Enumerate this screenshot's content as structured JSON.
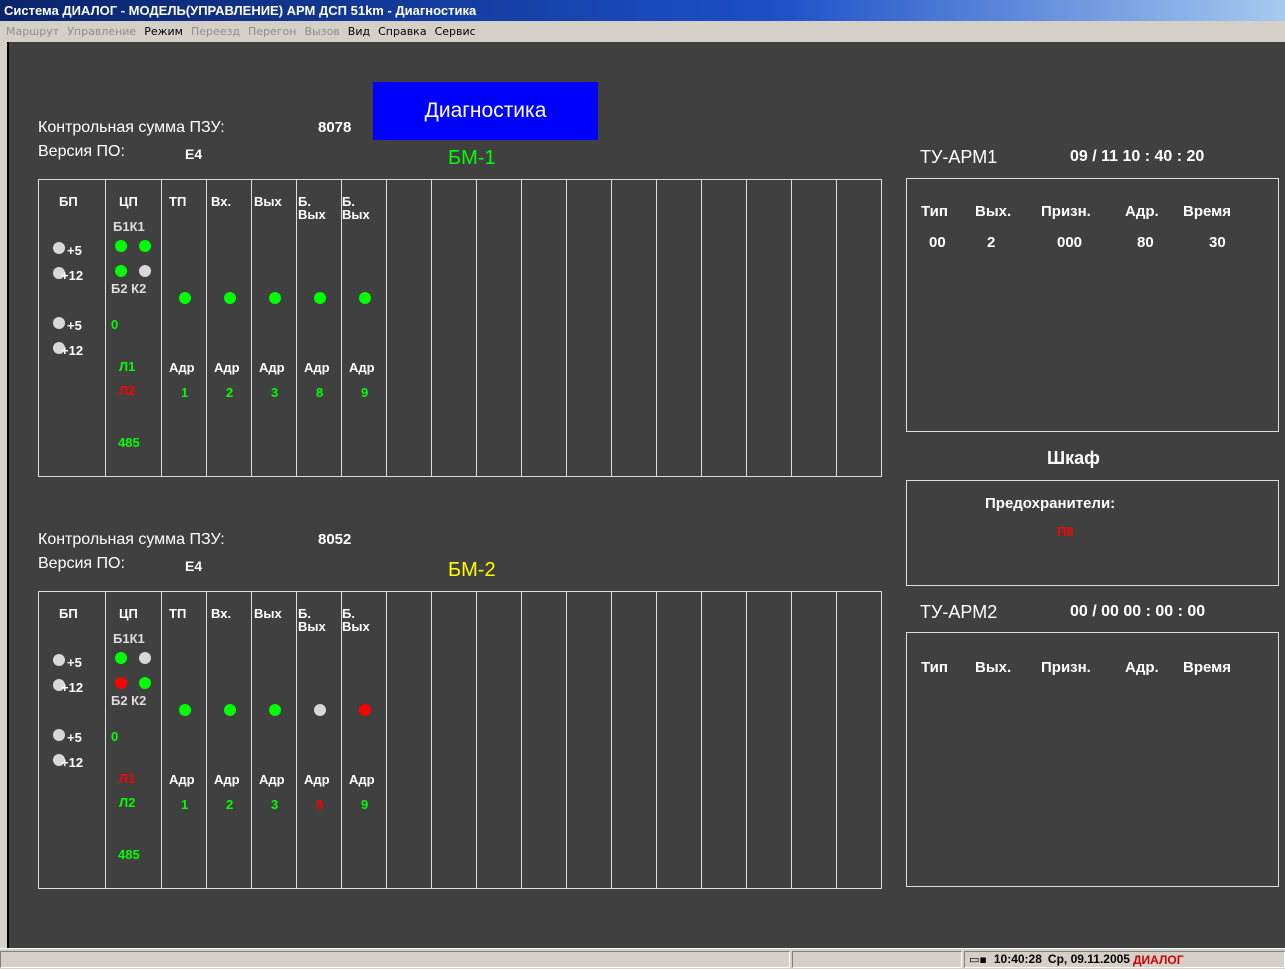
{
  "window": {
    "title": "Система ДИАЛОГ - МОДЕЛЬ(УПРАВЛЕНИЕ)  АРМ ДСП 51km - Диагностика"
  },
  "menu": [
    {
      "label": "Маршрут",
      "enabled": false
    },
    {
      "label": "Управление",
      "enabled": false
    },
    {
      "label": "Режим",
      "enabled": true
    },
    {
      "label": "Переезд",
      "enabled": false
    },
    {
      "label": "Перегон",
      "enabled": false
    },
    {
      "label": "Вызов",
      "enabled": false
    },
    {
      "label": "Вид",
      "enabled": true
    },
    {
      "label": "Справка",
      "enabled": true
    },
    {
      "label": "Сервис",
      "enabled": true
    }
  ],
  "diag_button": "Диагностика",
  "colors": {
    "green": "#00ff00",
    "red": "#ff0000",
    "gray": "#d8d8d8",
    "yellow": "#ffff00",
    "bg": "#404040"
  },
  "bm1": {
    "checksum_label": "Контрольная сумма ПЗУ:",
    "checksum": "8078",
    "version_label": "Версия ПО:",
    "version": "E4",
    "title": "БМ-1",
    "headers": [
      "БП",
      "ЦП",
      "ТП",
      "Вх.",
      "Вых",
      "Б.\nВых",
      "Б.\nВых"
    ],
    "power": [
      "+5",
      "+12",
      "+5",
      "+12"
    ],
    "power_dots": [
      "gray",
      "gray",
      "gray",
      "gray"
    ],
    "cp_top": "Б1К1",
    "cp_bottom": "Б2 К2",
    "cp_dots": [
      "green",
      "green",
      "green",
      "gray"
    ],
    "cp_zero": "0",
    "l1": "Л1",
    "l2": "Л2",
    "l1_color": "green",
    "l2_color": "red",
    "rs": "485",
    "mod_dots": [
      "green",
      "green",
      "green",
      "green",
      "green"
    ],
    "adr_label": "Адр",
    "addrs": [
      "1",
      "2",
      "3",
      "8",
      "9"
    ],
    "addr_colors": [
      "green",
      "green",
      "green",
      "green",
      "green"
    ]
  },
  "bm2": {
    "checksum_label": "Контрольная сумма ПЗУ:",
    "checksum": "8052",
    "version_label": "Версия ПО:",
    "version": "E4",
    "title": "БМ-2",
    "headers": [
      "БП",
      "ЦП",
      "ТП",
      "Вх.",
      "Вых",
      "Б.\nВых",
      "Б.\nВых"
    ],
    "power": [
      "+5",
      "+12",
      "+5",
      "+12"
    ],
    "power_dots": [
      "gray",
      "gray",
      "gray",
      "gray"
    ],
    "cp_top": "Б1К1",
    "cp_bottom": "Б2 К2",
    "cp_dots": [
      "green",
      "gray",
      "red",
      "green"
    ],
    "cp_zero": "0",
    "l1": "Л1",
    "l2": "Л2",
    "l1_color": "red",
    "l2_color": "green",
    "rs": "485",
    "mod_dots": [
      "green",
      "green",
      "green",
      "gray",
      "red"
    ],
    "adr_label": "Адр",
    "addrs": [
      "1",
      "2",
      "3",
      "8",
      "9"
    ],
    "addr_colors": [
      "green",
      "green",
      "green",
      "red",
      "green"
    ]
  },
  "tu1": {
    "title": "ТУ-АРМ1",
    "time": "09 / 11   10 : 40 : 20",
    "headers": [
      "Тип",
      "Вых.",
      "Призн.",
      "Адр.",
      "Время"
    ],
    "row": [
      "00",
      "2",
      "000",
      "80",
      "30"
    ]
  },
  "cabinet": {
    "title": "Шкаф",
    "fuses_label": "Предохранители:",
    "fuse": "П6"
  },
  "tu2": {
    "title": "ТУ-АРМ2",
    "time": "00 / 00   00 : 00 : 00",
    "headers": [
      "Тип",
      "Вых.",
      "Призн.",
      "Адр.",
      "Время"
    ]
  },
  "status": {
    "time": "10:40:28",
    "date": "Ср, 09.11.2005",
    "logo": "ДИАЛОГ"
  }
}
